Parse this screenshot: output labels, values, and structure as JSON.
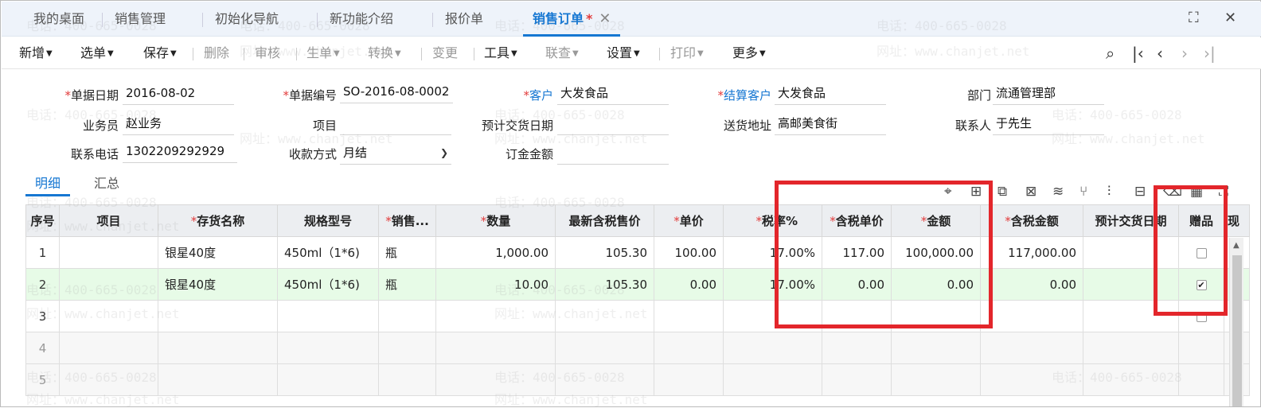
{
  "tabs": [
    {
      "label": "我的桌面"
    },
    {
      "label": "销售管理"
    },
    {
      "label": "初始化导航"
    },
    {
      "label": "新功能介绍"
    },
    {
      "label": "报价单"
    },
    {
      "label": "销售订单",
      "modified": "*"
    }
  ],
  "toolbar": {
    "new": "新增",
    "select": "选单",
    "save": "保存",
    "delete": "删除",
    "audit": "审核",
    "gen": "生单",
    "convert": "转换",
    "change": "变更",
    "tools": "工具",
    "query": "联查",
    "settings": "设置",
    "print": "打印",
    "more": "更多"
  },
  "form": {
    "date_label": "单据日期",
    "date": "2016-08-02",
    "code_label": "单据编号",
    "code": "SO-2016-08-0002",
    "customer_label": "客户",
    "customer": "大发食品",
    "settle_label": "结算客户",
    "settle": "大发食品",
    "dept_label": "部门",
    "dept": "流通管理部",
    "salesman_label": "业务员",
    "salesman": "赵业务",
    "project_label": "项目",
    "project": "",
    "expected_label": "预计交货日期",
    "expected": "",
    "address_label": "送货地址",
    "address": "高邮美食街",
    "contact_label": "联系人",
    "contact": "于先生",
    "phone_label": "联系电话",
    "phone": "1302209292929",
    "payment_label": "收款方式",
    "payment": "月结",
    "deposit_label": "订金金额",
    "deposit": ""
  },
  "subtabs": {
    "detail": "明细",
    "summary": "汇总"
  },
  "grid": {
    "headers": [
      "序号",
      "项目",
      "存货名称",
      "规格型号",
      "销售...",
      "数量",
      "最新含税售价",
      "单价",
      "税率%",
      "含税单价",
      "金额",
      "含税金额",
      "预计交货日期",
      "赠品",
      "现"
    ],
    "rows": [
      {
        "seq": "1",
        "project": "",
        "name": "银星40度",
        "spec": "450ml（1*6)",
        "unit": "瓶",
        "qty": "1,000.00",
        "latest": "105.30",
        "price": "100.00",
        "tax": "17.00%",
        "taxprice": "117.00",
        "amount": "100,000.00",
        "taxamount": "117,000.00",
        "date": "",
        "gift": false
      },
      {
        "seq": "2",
        "project": "",
        "name": "银星40度",
        "spec": "450ml（1*6)",
        "unit": "瓶",
        "qty": "10.00",
        "latest": "105.30",
        "price": "0.00",
        "tax": "17.00%",
        "taxprice": "0.00",
        "amount": "0.00",
        "taxamount": "0.00",
        "date": "",
        "gift": true
      },
      {
        "seq": "3"
      },
      {
        "seq": "4"
      },
      {
        "seq": "5"
      }
    ]
  },
  "watermark": {
    "phone": "电话：400-665-0028",
    "site": "网址：www.chanjet.net"
  },
  "colors": {
    "accent": "#1677d2",
    "required": "#e23b3b",
    "highlight": "#e3262b",
    "selected_row": "#e7fbe7"
  }
}
